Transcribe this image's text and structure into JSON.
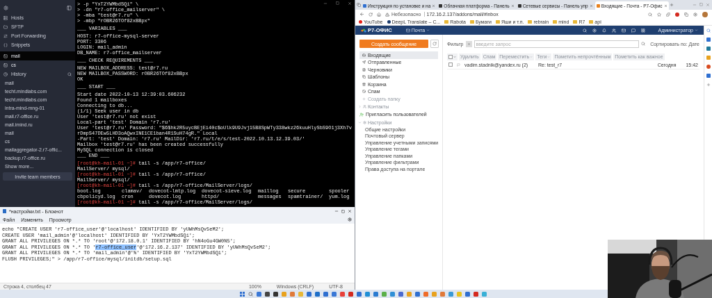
{
  "terminal_app": {
    "sidebar": {
      "nav": [
        "Hosts",
        "SFTP",
        "Port Forwarding",
        "Snippets"
      ],
      "sessions": [
        {
          "label": "mail",
          "selected": true
        },
        {
          "label": "cs",
          "selected": false
        }
      ],
      "history": {
        "title": "History",
        "items": [
          "mail",
          "techt.mindlabs.com",
          "techt.mindlabs.com",
          "intra-mind-mng-01",
          "mail.r7-office.ru",
          "mail.imind.ru",
          "mail",
          "cs",
          "mailaggregator-2.r7-offic...",
          "backup.r7-office.ru"
        ],
        "show_more": "Show more...",
        "invite_button": "Invite team members"
      }
    },
    "terminal": {
      "lines": [
        {
          "kind": "text",
          "text": "> -p \"YxT2YWMbdSQi\" \\"
        },
        {
          "kind": "text",
          "text": "> -dn \"r7-office_mailserver\" \\"
        },
        {
          "kind": "text",
          "text": "> -mba \"test@r7.ru\" \\"
        },
        {
          "kind": "text",
          "text": "> -mbp \"rOBR26TOf82xBBpx\""
        },
        {
          "kind": "blank"
        },
        {
          "kind": "text",
          "text": "___ VARIABLES ___"
        },
        {
          "kind": "blank"
        },
        {
          "kind": "text",
          "text": "HOST: r7-office-mysql-server"
        },
        {
          "kind": "text",
          "text": "PORT: 3306"
        },
        {
          "kind": "text",
          "text": "LOGIN: mail_admin"
        },
        {
          "kind": "text",
          "text": "DB_NAME: r7-office_mailserver"
        },
        {
          "kind": "blank"
        },
        {
          "kind": "text",
          "text": "___ CHECK REQUIREMENTS ___"
        },
        {
          "kind": "blank"
        },
        {
          "kind": "text",
          "text": "NEW MAILBOX_ADDRESS: test@r7.ru"
        },
        {
          "kind": "text",
          "text": "NEW MAILBOX_PASSWORD: rOBR26TOf82xBBpx"
        },
        {
          "kind": "text",
          "text": "OK"
        },
        {
          "kind": "blank"
        },
        {
          "kind": "text",
          "text": "___ START ___"
        },
        {
          "kind": "blank"
        },
        {
          "kind": "text",
          "text": "Start date 2022-10-13 12:39:03.606232"
        },
        {
          "kind": "text",
          "text": "Found 1 mailboxes"
        },
        {
          "kind": "text",
          "text": "Connecting to db..."
        },
        {
          "kind": "text",
          "text": "(1/1) Seek user in db"
        },
        {
          "kind": "text",
          "text": "User 'test@r7.ru' not exist"
        },
        {
          "kind": "text",
          "text": "Local-part 'test' Domain 'r7.ru'"
        },
        {
          "kind": "text",
          "text": "User 'test@r7.ru' Password: \"$6$hk2R5uycBEjEi40c$oUlk9U9Jvj15B8SpWTy338wkz26kuuHlySbS9O1j3Xh7vrDmpS47DEw5LHD3oAQwxINE1CE1ban4R1SuH74gR.\" Local"
        },
        {
          "kind": "text",
          "text": "-Part: 'test' Domain: 'r7.ru' MailDir: 'r7.ru/t/e/s/test-2022.10.13.12.39.03/'"
        },
        {
          "kind": "text",
          "text": "Mailbox 'test@r7.ru' has been created successfully"
        },
        {
          "kind": "text",
          "text": "MySQL connection is closed"
        },
        {
          "kind": "text",
          "text": "___ END ___"
        },
        {
          "kind": "blank"
        },
        {
          "kind": "prompt",
          "prompt": "[root@kh-mail-01 ~]#",
          "command": "tail -s /app/r7-office/"
        },
        {
          "kind": "text",
          "text": "MailServer/ mysql/"
        },
        {
          "kind": "prompt",
          "prompt": "[root@kh-mail-01 ~]#",
          "command": "tail -s /app/r7-office/"
        },
        {
          "kind": "text",
          "text": "MailServer/ mysql/"
        },
        {
          "kind": "prompt",
          "prompt": "[root@kh-mail-01 ~]#",
          "command": "tail -s /app/r7-office/MailServer/logs/"
        },
        {
          "kind": "columns",
          "cells": [
            "boot.log",
            "clamav/",
            "dovecot-lmtp.log",
            "dovecot-sieve.log",
            "maillog",
            "secure",
            "spooler"
          ]
        },
        {
          "kind": "columns",
          "cells": [
            "cbpolicyd.log",
            "cron",
            "dovecot.log",
            "httpd/",
            "messages",
            "spamtrainer/",
            "yum.log"
          ]
        },
        {
          "kind": "prompt",
          "prompt": "[root@kh-mail-01 ~]#",
          "command": "tail -s /app/r7-office/MailServer/logs/"
        }
      ]
    }
  },
  "notepad": {
    "title": "*настройки.txt - Блокнот",
    "menu": [
      "Файл",
      "Изменить",
      "Просмотр"
    ],
    "lines": [
      {
        "segments": [
          {
            "text": "echo \"CREATE USER 'r7-office_user'@'localhost' IDENTIFIED BY 'yUWhMsQv5eM2';",
            "selected": false
          }
        ]
      },
      {
        "segments": [
          {
            "text": "CREATE USER 'mail_admin'@'localhost' IDENTIFIED BY 'YxT2YWMbdSQi';",
            "selected": false
          }
        ]
      },
      {
        "segments": [
          {
            "text": "GRANT ALL PRIVILEGES ON *.* TO 'root'@'172.18.0.1' IDENTIFIED BY 'hN4oGu4GW0N5';",
            "selected": false
          }
        ]
      },
      {
        "segments": [
          {
            "text": "GRANT ALL PRIVILEGES ON *.* TO '",
            "selected": false
          },
          {
            "text": "r7-office_user",
            "selected": true
          },
          {
            "text": "'@'172.16.2.137' IDENTIFIED BY 'yUWhMsQv5eM2';",
            "selected": false
          }
        ]
      },
      {
        "segments": [
          {
            "text": "GRANT ALL PRIVILEGES ON *.* TO 'mail_admin'@'%' IDENTIFIED BY 'YxT2YWMbdSQi';",
            "selected": false
          }
        ]
      },
      {
        "segments": [
          {
            "text": "FLUSH PRIVILEGES;\" > /app/r7-office/mysql/initdb/setup.sql",
            "selected": false
          }
        ]
      }
    ],
    "status": {
      "position": "Строка 4, столбец 47",
      "zoom": "100%",
      "line_endings": "Windows (CRLF)",
      "encoding": "UTF-8"
    }
  },
  "browser": {
    "tabs": [
      {
        "title": "Инструкция по установке и на",
        "selected": false
      },
      {
        "title": "Облачная платформа - Панель",
        "selected": false
      },
      {
        "title": "Сетевые сервисы - Панель упр",
        "selected": false
      },
      {
        "title": "Входящие - Почта - Р7-Офис",
        "selected": true
      }
    ],
    "address": {
      "security": "Небезопасно",
      "url": "172.16.2.137/addons/mail/#inbox"
    },
    "bookmarks": [
      {
        "label": "YouTube",
        "kind": "site"
      },
      {
        "label": "DeepL Translate – C...",
        "kind": "site"
      },
      {
        "label": "Rabota",
        "kind": "folder"
      },
      {
        "label": "Бумаги",
        "kind": "folder"
      },
      {
        "label": "Яши и т.п.",
        "kind": "folder"
      },
      {
        "label": "rebrain",
        "kind": "folder"
      },
      {
        "label": "mind",
        "kind": "folder"
      },
      {
        "label": "R7",
        "kind": "folder"
      },
      {
        "label": "api",
        "kind": "folder"
      }
    ],
    "app": {
      "logo": "Р7-ОФИС",
      "module": "Почта",
      "user": "Администратор",
      "compose_button": "Создать сообщение",
      "folders": [
        {
          "label": "Входящие",
          "selected": true
        },
        {
          "label": "Отправленные",
          "selected": false
        },
        {
          "label": "Черновики",
          "selected": false
        },
        {
          "label": "Шаблоны",
          "selected": false
        },
        {
          "label": "Корзина",
          "selected": false
        },
        {
          "label": "Спам",
          "selected": false
        }
      ],
      "create_folder": "Создать папку",
      "contacts": {
        "label": "Контакты",
        "expanded": false
      },
      "invite": "Пригласить пользователей",
      "settings": {
        "label": "Настройки",
        "expanded": true,
        "children": [
          "Общие настройки",
          "Почтовый сервер",
          "Управление учетными записями",
          "Управление тегами",
          "Управление папками",
          "Управление фильтрами",
          "Права доступа на портале"
        ]
      },
      "filter": {
        "label": "Фильтр",
        "placeholder": "введите запрос"
      },
      "sort": "Сортировать по: Дате",
      "select_all": {
        "checked": false
      },
      "toolbar": [
        {
          "label": "Удалить",
          "dropdown": false
        },
        {
          "label": "Спам",
          "dropdown": false
        },
        {
          "label": "Переместить",
          "dropdown": true
        },
        {
          "label": "Теги",
          "dropdown": true
        },
        {
          "label": "Пометить непрочтённым",
          "dropdown": false
        },
        {
          "label": "Пометить как важное",
          "dropdown": false
        }
      ],
      "messages": [
        {
          "sender": "vadim.stadnik@yandex.ru (2)",
          "subject": "Re: test_r7",
          "date": "Сегодня",
          "time": "15:42",
          "checked": false
        }
      ]
    }
  }
}
